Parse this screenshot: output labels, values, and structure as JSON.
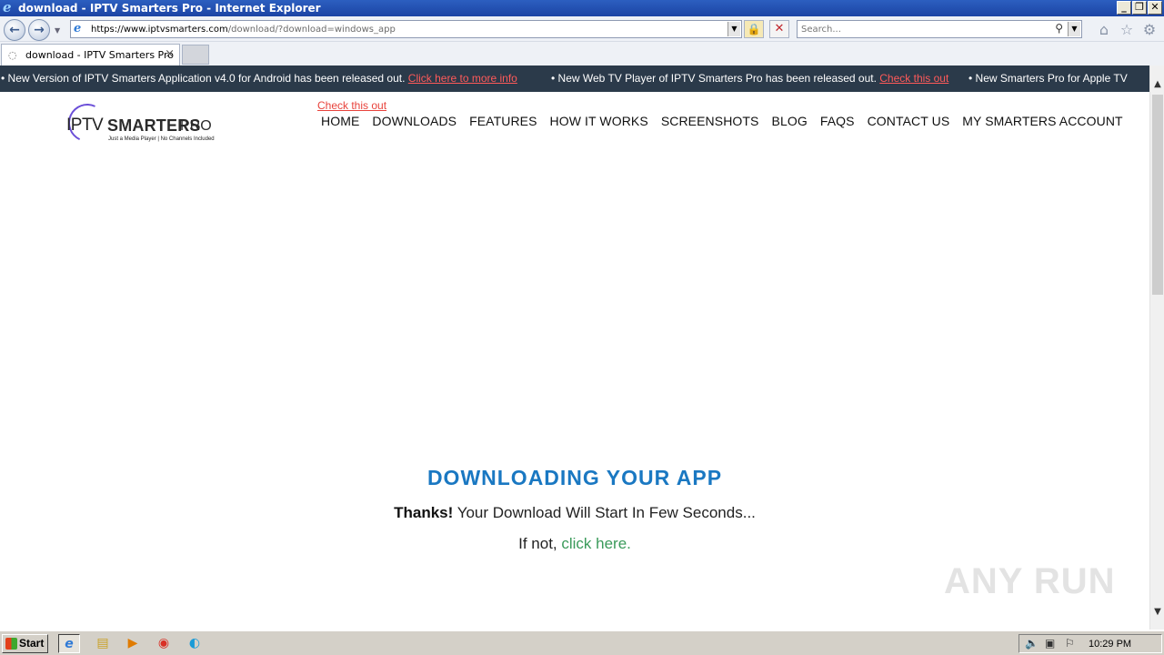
{
  "window": {
    "title": "download - IPTV Smarters Pro - Internet Explorer",
    "controls": {
      "minimize": "_",
      "restore": "❐",
      "close": "✕"
    }
  },
  "browser": {
    "url_host": "https://www.iptvsmarters.com",
    "url_path": "/download/?download=windows_app",
    "search_placeholder": "Search...",
    "tab_label": "download - IPTV Smarters Pro"
  },
  "ticker": {
    "items": [
      {
        "text": "• New Version of IPTV Smarters Application v4.0 for Android has been released out.",
        "link": "Click here to more info"
      },
      {
        "text": "• New Web TV Player of IPTV Smarters Pro has been released out.",
        "link": "Check this out"
      },
      {
        "text": "• New Smarters Pro for Apple TV",
        "link": ""
      }
    ]
  },
  "logo": {
    "iptv": "IPTV",
    "smarters": "SMARTERS",
    "pro": "PRO",
    "tagline": "Just a Media Player | No Channels Included"
  },
  "header": {
    "check_link": "Check this out",
    "nav": [
      "HOME",
      "DOWNLOADS",
      "FEATURES",
      "HOW IT WORKS",
      "SCREENSHOTS",
      "BLOG",
      "FAQS",
      "CONTACT US",
      "MY SMARTERS ACCOUNT"
    ]
  },
  "main": {
    "title": "DOWNLOADING YOUR APP",
    "thanks": "Thanks!",
    "message": " Your Download Will Start In Few Seconds...",
    "fallback_prefix": "If not, ",
    "fallback_link": "click here."
  },
  "watermark": "ANY RUN",
  "taskbar": {
    "start": "Start",
    "clock": "10:29 PM"
  }
}
